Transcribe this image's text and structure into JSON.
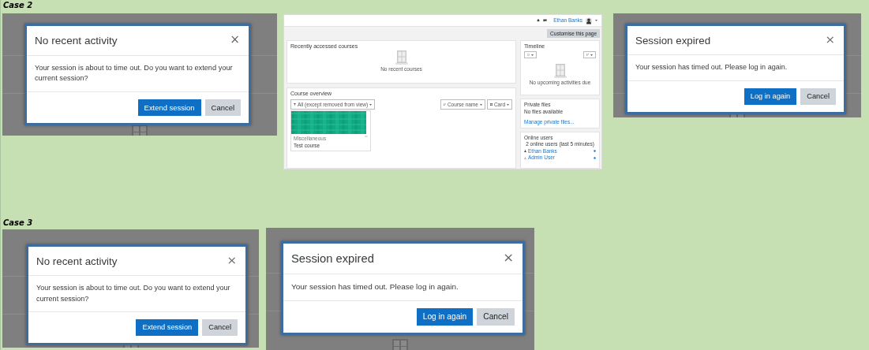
{
  "sections": [
    {
      "label": "Case 2",
      "items": [
        {
          "kind": "dialog",
          "title": "No recent activity",
          "close": "×",
          "message": "Your session is about to time out. Do you want to extend your current session?",
          "buttons": [
            {
              "label": "Extend session",
              "kind": "primary"
            },
            {
              "label": "Cancel",
              "kind": "secondary"
            }
          ]
        },
        {
          "kind": "dashboard",
          "user_name": "Ethan Banks",
          "customise": "Customise this page",
          "recent": {
            "title": "Recently accessed courses",
            "empty": "No recent courses"
          },
          "timeline": {
            "title": "Timeline",
            "empty": "No upcoming activities due"
          },
          "overview": {
            "title": "Course overview",
            "filter": "All (except removed from view)",
            "sort": "Course name",
            "view": "Card",
            "course": {
              "category": "Miscellaneous",
              "name": "Test course"
            }
          },
          "private_files": {
            "title": "Private files",
            "empty": "No files available",
            "link": "Manage private files..."
          },
          "online_users": {
            "title": "Online users",
            "summary": "2 online users (last 5 minutes)",
            "users": [
              "Ethan Banks",
              "Admin User"
            ]
          }
        },
        {
          "kind": "dialog",
          "title": "Session expired",
          "close": "×",
          "message": "Your session has timed out. Please log in again.",
          "buttons": [
            {
              "label": "Log in again",
              "kind": "primary"
            },
            {
              "label": "Cancel",
              "kind": "secondary"
            }
          ]
        }
      ]
    },
    {
      "label": "Case 3",
      "items": [
        {
          "kind": "dialog",
          "title": "No recent activity",
          "close": "×",
          "message": "Your session is about to time out. Do you want to extend your current session?",
          "buttons": [
            {
              "label": "Extend session",
              "kind": "primary"
            },
            {
              "label": "Cancel",
              "kind": "secondary"
            }
          ]
        },
        {
          "kind": "dialog",
          "title": "Session expired",
          "close": "×",
          "message": "Your session has timed out. Please log in again.",
          "buttons": [
            {
              "label": "Log in again",
              "kind": "primary"
            },
            {
              "label": "Cancel",
              "kind": "secondary"
            }
          ]
        }
      ]
    }
  ]
}
